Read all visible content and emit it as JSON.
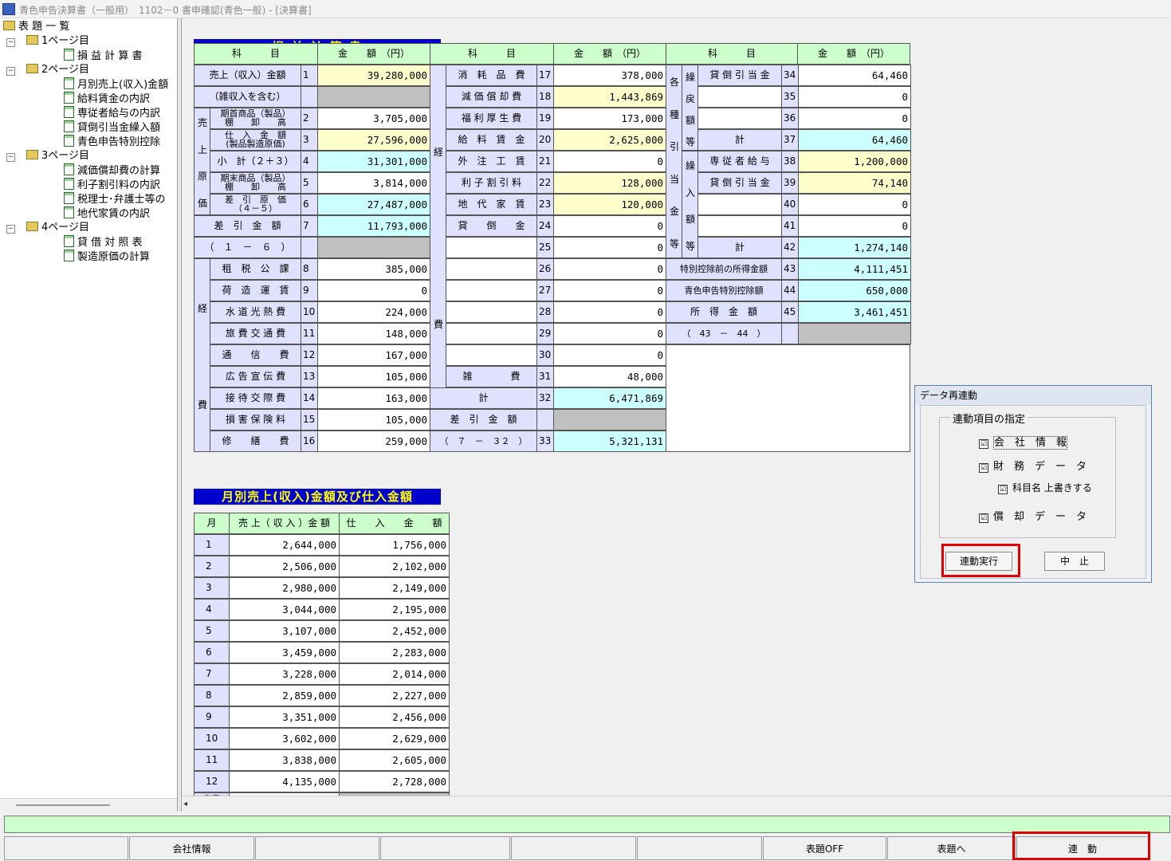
{
  "window": {
    "title": "青色申告決算書（一般用）　1102－0 書申確認(青色一般) - [決算書]"
  },
  "tree": {
    "root": "表 題 一 覧",
    "pages": [
      {
        "label": "1ページ目",
        "items": [
          "損 益 計 算 書"
        ]
      },
      {
        "label": "2ページ目",
        "items": [
          "月別売上(収入)金額",
          "給料賃金の内訳",
          "専従者給与の内訳",
          "貸倒引当金繰入額",
          "青色申告特別控除"
        ]
      },
      {
        "label": "3ページ目",
        "items": [
          "減価償却費の計算",
          "利子割引料の内訳",
          "税理士･弁護士等の",
          "地代家賃の内訳"
        ]
      },
      {
        "label": "4ページ目",
        "items": [
          "貸 借 対 照 表",
          "製造原価の計算"
        ]
      }
    ]
  },
  "pl": {
    "title": "損 益 計 算 書",
    "h_kamoku": "科　　　目",
    "h_kingaku": "金　　額　（円）",
    "side": {
      "uriage_genka": [
        "売",
        "上",
        "原",
        "価"
      ],
      "keihi_a": [
        "経",
        "費"
      ],
      "keihi_b": [
        "経",
        "費"
      ],
      "hiki": [
        "各",
        "種",
        "引",
        "当",
        "金",
        "等"
      ],
      "kuri_m": [
        "繰",
        "戻",
        "額",
        "等"
      ],
      "kuri_i": [
        "繰",
        "入",
        "額",
        "等"
      ]
    },
    "col1": [
      {
        "l": "売上（収入）金額",
        "n": "1",
        "v": "39,280,000"
      },
      {
        "l": "（雑収入を含む）"
      },
      {
        "l": "期首商品（製品）\n棚　　卸　　高",
        "n": "2",
        "v": "3,705,000"
      },
      {
        "l": "仕　入　金　額\n(製品製造原価)",
        "n": "3",
        "v": "27,596,000"
      },
      {
        "l": "小　計（２＋３）",
        "n": "4",
        "v": "31,301,000"
      },
      {
        "l": "期末商品（製品）\n棚　　卸　　高",
        "n": "5",
        "v": "3,814,000"
      },
      {
        "l": "差　引　原　価\n（４－５）",
        "n": "6",
        "v": "27,487,000"
      },
      {
        "l": "差　引　金　額",
        "n": "7",
        "v": "11,793,000"
      },
      {
        "l": "（　１　－　６　）"
      },
      {
        "l": "租　税　公　課",
        "n": "8",
        "v": "385,000"
      },
      {
        "l": "荷　造　運　賃",
        "n": "9",
        "v": "0"
      },
      {
        "l": "水 道 光 熱 費",
        "n": "10",
        "v": "224,000"
      },
      {
        "l": "旅 費 交 通 費",
        "n": "11",
        "v": "148,000"
      },
      {
        "l": "通　　信　　費",
        "n": "12",
        "v": "167,000"
      },
      {
        "l": "広 告 宣 伝 費",
        "n": "13",
        "v": "105,000"
      },
      {
        "l": "接 待 交 際 費",
        "n": "14",
        "v": "163,000"
      },
      {
        "l": "損 害 保 険 料",
        "n": "15",
        "v": "105,000"
      },
      {
        "l": "修　　繕　　費",
        "n": "16",
        "v": "259,000"
      }
    ],
    "col2": [
      {
        "l": "消　耗　品　費",
        "n": "17",
        "v": "378,000"
      },
      {
        "l": "減 価 償 却 費",
        "n": "18",
        "v": "1,443,869"
      },
      {
        "l": "福 利 厚 生 費",
        "n": "19",
        "v": "173,000"
      },
      {
        "l": "給　料　賃　金",
        "n": "20",
        "v": "2,625,000"
      },
      {
        "l": "外　注　工　賃",
        "n": "21",
        "v": "0"
      },
      {
        "l": "利 子 割 引 料",
        "n": "22",
        "v": "128,000"
      },
      {
        "l": "地　代　家　賃",
        "n": "23",
        "v": "120,000"
      },
      {
        "l": "貸　　倒　　金",
        "n": "24",
        "v": "0"
      },
      {
        "l": "",
        "n": "25",
        "v": "0"
      },
      {
        "l": "",
        "n": "26",
        "v": "0"
      },
      {
        "l": "",
        "n": "27",
        "v": "0"
      },
      {
        "l": "",
        "n": "28",
        "v": "0"
      },
      {
        "l": "",
        "n": "29",
        "v": "0"
      },
      {
        "l": "",
        "n": "30",
        "v": "0"
      },
      {
        "l": "雑　　　　費",
        "n": "31",
        "v": "48,000"
      },
      {
        "l": "計",
        "n": "32",
        "v": "6,471,869"
      },
      {
        "l": "差　引　金　額"
      },
      {
        "l": "（　７　－　３２　）",
        "n": "33",
        "v": "5,321,131"
      }
    ],
    "col3": [
      {
        "l": "貸 倒 引 当 金",
        "n": "34",
        "v": "64,460"
      },
      {
        "l": "",
        "n": "35",
        "v": "0"
      },
      {
        "l": "",
        "n": "36",
        "v": "0"
      },
      {
        "l": "計",
        "n": "37",
        "v": "64,460"
      },
      {
        "l": "専 従 者 給 与",
        "n": "38",
        "v": "1,200,000"
      },
      {
        "l": "貸 倒 引 当 金",
        "n": "39",
        "v": "74,140"
      },
      {
        "l": "",
        "n": "40",
        "v": "0"
      },
      {
        "l": "",
        "n": "41",
        "v": "0"
      },
      {
        "l": "計",
        "n": "42",
        "v": "1,274,140"
      },
      {
        "l": "特別控除前の所得金額",
        "n": "43",
        "v": "4,111,451"
      },
      {
        "l": "青色申告特別控除額",
        "n": "44",
        "v": "650,000"
      },
      {
        "l": "所　得　金　額",
        "n": "45",
        "v": "3,461,451"
      },
      {
        "l": "（　43　－　44　）"
      }
    ]
  },
  "monthly": {
    "title": "月別売上(収入)金額及び仕入金額",
    "headers": [
      "月",
      "売 上（ 収 入 ）金 額",
      "仕　　入　　金　　額"
    ],
    "rows": [
      [
        "1",
        "2,644,000",
        "1,756,000"
      ],
      [
        "2",
        "2,506,000",
        "2,102,000"
      ],
      [
        "3",
        "2,980,000",
        "2,149,000"
      ],
      [
        "4",
        "3,044,000",
        "2,195,000"
      ],
      [
        "5",
        "3,107,000",
        "2,452,000"
      ],
      [
        "6",
        "3,459,000",
        "2,283,000"
      ],
      [
        "7",
        "3,228,000",
        "2,014,000"
      ],
      [
        "8",
        "2,859,000",
        "2,227,000"
      ],
      [
        "9",
        "3,351,000",
        "2,456,000"
      ],
      [
        "10",
        "3,602,000",
        "2,629,000"
      ],
      [
        "11",
        "3,838,000",
        "2,605,000"
      ],
      [
        "12",
        "4,135,000",
        "2,728,000"
      ]
    ],
    "last_label": "家事"
  },
  "dialog": {
    "title": "データ再連動",
    "group_label": "連動項目の指定",
    "options": [
      {
        "label": "会　社　情　報",
        "checked": "☑"
      },
      {
        "label": "財　務　デ　ー　タ",
        "checked": "☑"
      },
      {
        "label": "科目名 上書きする",
        "checked": "☑"
      },
      {
        "label": "償　却　デ　ー　タ",
        "checked": "☑"
      }
    ],
    "run_button": "連動実行",
    "stop_button": "中　止"
  },
  "footer": {
    "buttons": [
      "",
      "会社情報",
      "",
      "",
      "",
      "",
      "表題OFF",
      "表題へ",
      "連　動"
    ]
  },
  "colors": {
    "title_bg": "#0000cc",
    "title_fg": "#ffff00",
    "header_bg": "#ccffcc",
    "label_bg": "#e0e0ff",
    "total_bg": "#ccffff",
    "input_bg": "#ffffcc",
    "highlight": "#e00000"
  }
}
